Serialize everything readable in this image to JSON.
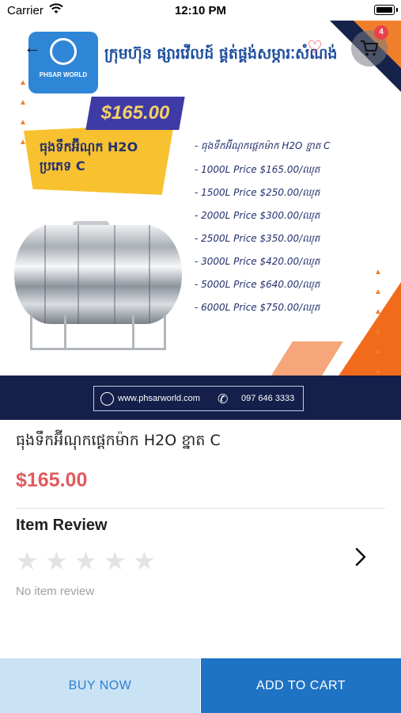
{
  "status_bar": {
    "carrier": "Carrier",
    "time": "12:10 PM"
  },
  "banner": {
    "logo_text": "PHSAR WORLD",
    "company_name": "ក្រុមហ៊ុន ផ្សារវើលដ៍ ផ្គត់ផ្គង់សម្ភារៈសំណង់",
    "price_tag": "$165.00",
    "badge_text": "ធុងទឹកអ៊ីណុក H2O ប្រភេទ C",
    "spec_title": "- ធុងទឹកអ៊ីណុកផ្តេកម៉ាក H2O ខ្នាត C",
    "specs": [
      "- 1000L    Price $165.00/ឈុត",
      "- 1500L   Price $250.00/ឈុត",
      "- 2000L   Price $300.00/ឈុត",
      "- 2500L    Price $350.00/ឈុត",
      "- 3000L    Price $420.00/ឈុត",
      "- 5000L   Price $640.00/ឈុត",
      "- 6000L   Price $750.00/ឈុត"
    ],
    "website": "www.phsarworld.com",
    "phone": "097 646 3333",
    "colors": {
      "navy": "#14204a",
      "orange": "#f26a1b",
      "brand_blue": "#2f86d6",
      "badge_yellow": "#f7c130"
    }
  },
  "nav": {
    "back_icon": "back-arrow-icon",
    "favorite_icon": "heart-icon",
    "cart_icon": "cart-icon",
    "cart_count": "4"
  },
  "product": {
    "title": "ធុងទឹកអ៊ីណុកផ្តេកម៉ាក H2O ខ្នាត C",
    "price": "$165.00",
    "price_color": "#e05a5f"
  },
  "review": {
    "heading": "Item Review",
    "rating": 0,
    "max_rating": 5,
    "empty_text": "No item review"
  },
  "actions": {
    "buy_now": "BUY NOW",
    "add_to_cart": "ADD TO CART",
    "buy_now_color": "#c9e2f4",
    "add_to_cart_color": "#1e73c4"
  }
}
